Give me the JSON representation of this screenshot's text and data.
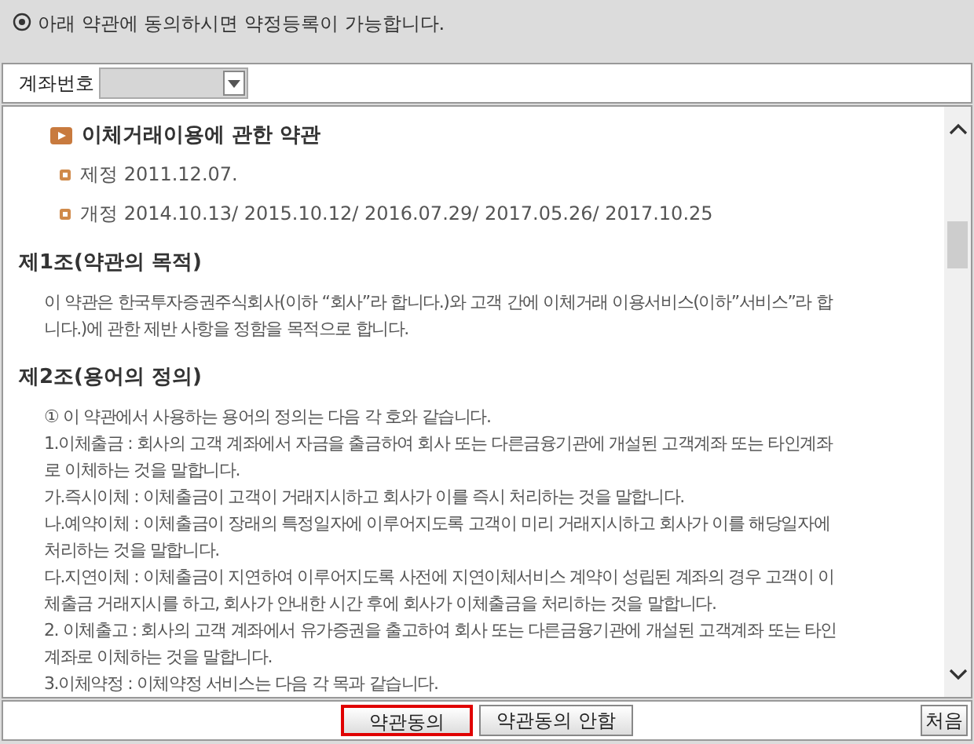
{
  "notice": "아래 약관에 동의하시면 약정등록이 가능합니다.",
  "account": {
    "label": "계좌번호"
  },
  "document": {
    "title": "이체거래이용에 관한 약관",
    "dates": [
      "제정 2011.12.07.",
      "개정 2014.10.13/ 2015.10.12/ 2016.07.29/ 2017.05.26/ 2017.10.25"
    ],
    "sections": [
      {
        "heading": "제1조(약관의 목적)",
        "lines": [
          "이 약관은 한국투자증권주식회사(이하 “회사”라 합니다.)와 고객 간에 이체거래 이용서비스(이하”서비스”라 합",
          "니다.)에 관한 제반 사항을 정함을 목적으로 합니다."
        ]
      },
      {
        "heading": "제2조(용어의 정의)",
        "lines": [
          "① 이 약관에서 사용하는 용어의 정의는 다음 각 호와 같습니다.",
          "1.이체출금 : 회사의 고객 계좌에서 자금을 출금하여 회사 또는 다른금융기관에 개설된 고객계좌 또는 타인계좌",
          "로 이체하는 것을 말합니다.",
          "가.즉시이체 : 이체출금이 고객이 거래지시하고 회사가 이를 즉시 처리하는 것을 말합니다.",
          "나.예약이체 : 이체출금이 장래의 특정일자에 이루어지도록 고객이 미리 거래지시하고 회사가 이를 해당일자에",
          "처리하는 것을 말합니다.",
          "다.지연이체 : 이체출금이 지연하여 이루어지도록 사전에 지연이체서비스 계약이 성립된 계좌의 경우 고객이 이",
          "체출금 거래지시를 하고, 회사가 안내한 시간 후에 회사가 이체출금을 처리하는 것을 말합니다.",
          "2. 이체출고 : 회사의 고객 계좌에서 유가증권을 출고하여 회사 또는 다른금융기관에 개설된 고객계좌 또는 타인",
          "계좌로 이체하는 것을 말합니다.",
          "3.이체약정 : 이체약정 서비스는 다음 각 목과 같습니다."
        ]
      }
    ]
  },
  "buttons": [
    {
      "label": "약관동의",
      "focused": true
    },
    {
      "label": "약관동의 안함",
      "focused": false
    }
  ],
  "first_button": "처음"
}
